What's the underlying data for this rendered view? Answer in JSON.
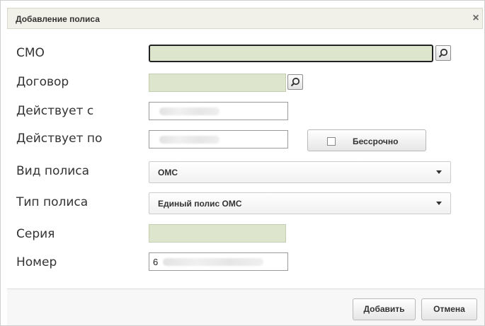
{
  "dialog": {
    "title": "Добавление полиса",
    "close_icon": "×"
  },
  "form": {
    "smo_label": "СМО",
    "smo_value": "",
    "dogovor_label": "Договор",
    "dogovor_value": "",
    "deystvuet_s_label": "Действует с",
    "deystvuet_po_label": "Действует по",
    "bessrochno_label": "Бессрочно",
    "vid_polisa_label": "Вид полиса",
    "vid_polisa_value": "ОМС",
    "tip_polisa_label": "Тип полиса",
    "tip_polisa_value": "Единый полис ОМС",
    "seriya_label": "Серия",
    "seriya_value": "",
    "nomer_label": "Номер",
    "nomer_value": "6"
  },
  "buttons": {
    "add": "Добавить",
    "cancel": "Отмена"
  },
  "icons": {
    "lookup": "search-icon",
    "close": "close-icon",
    "dropdown": "chevron-down-icon",
    "checkbox": "checkbox-unchecked-icon"
  },
  "colors": {
    "required_field_bg": "#dde6cc",
    "titlebar_bg": "#f1f0e9"
  }
}
